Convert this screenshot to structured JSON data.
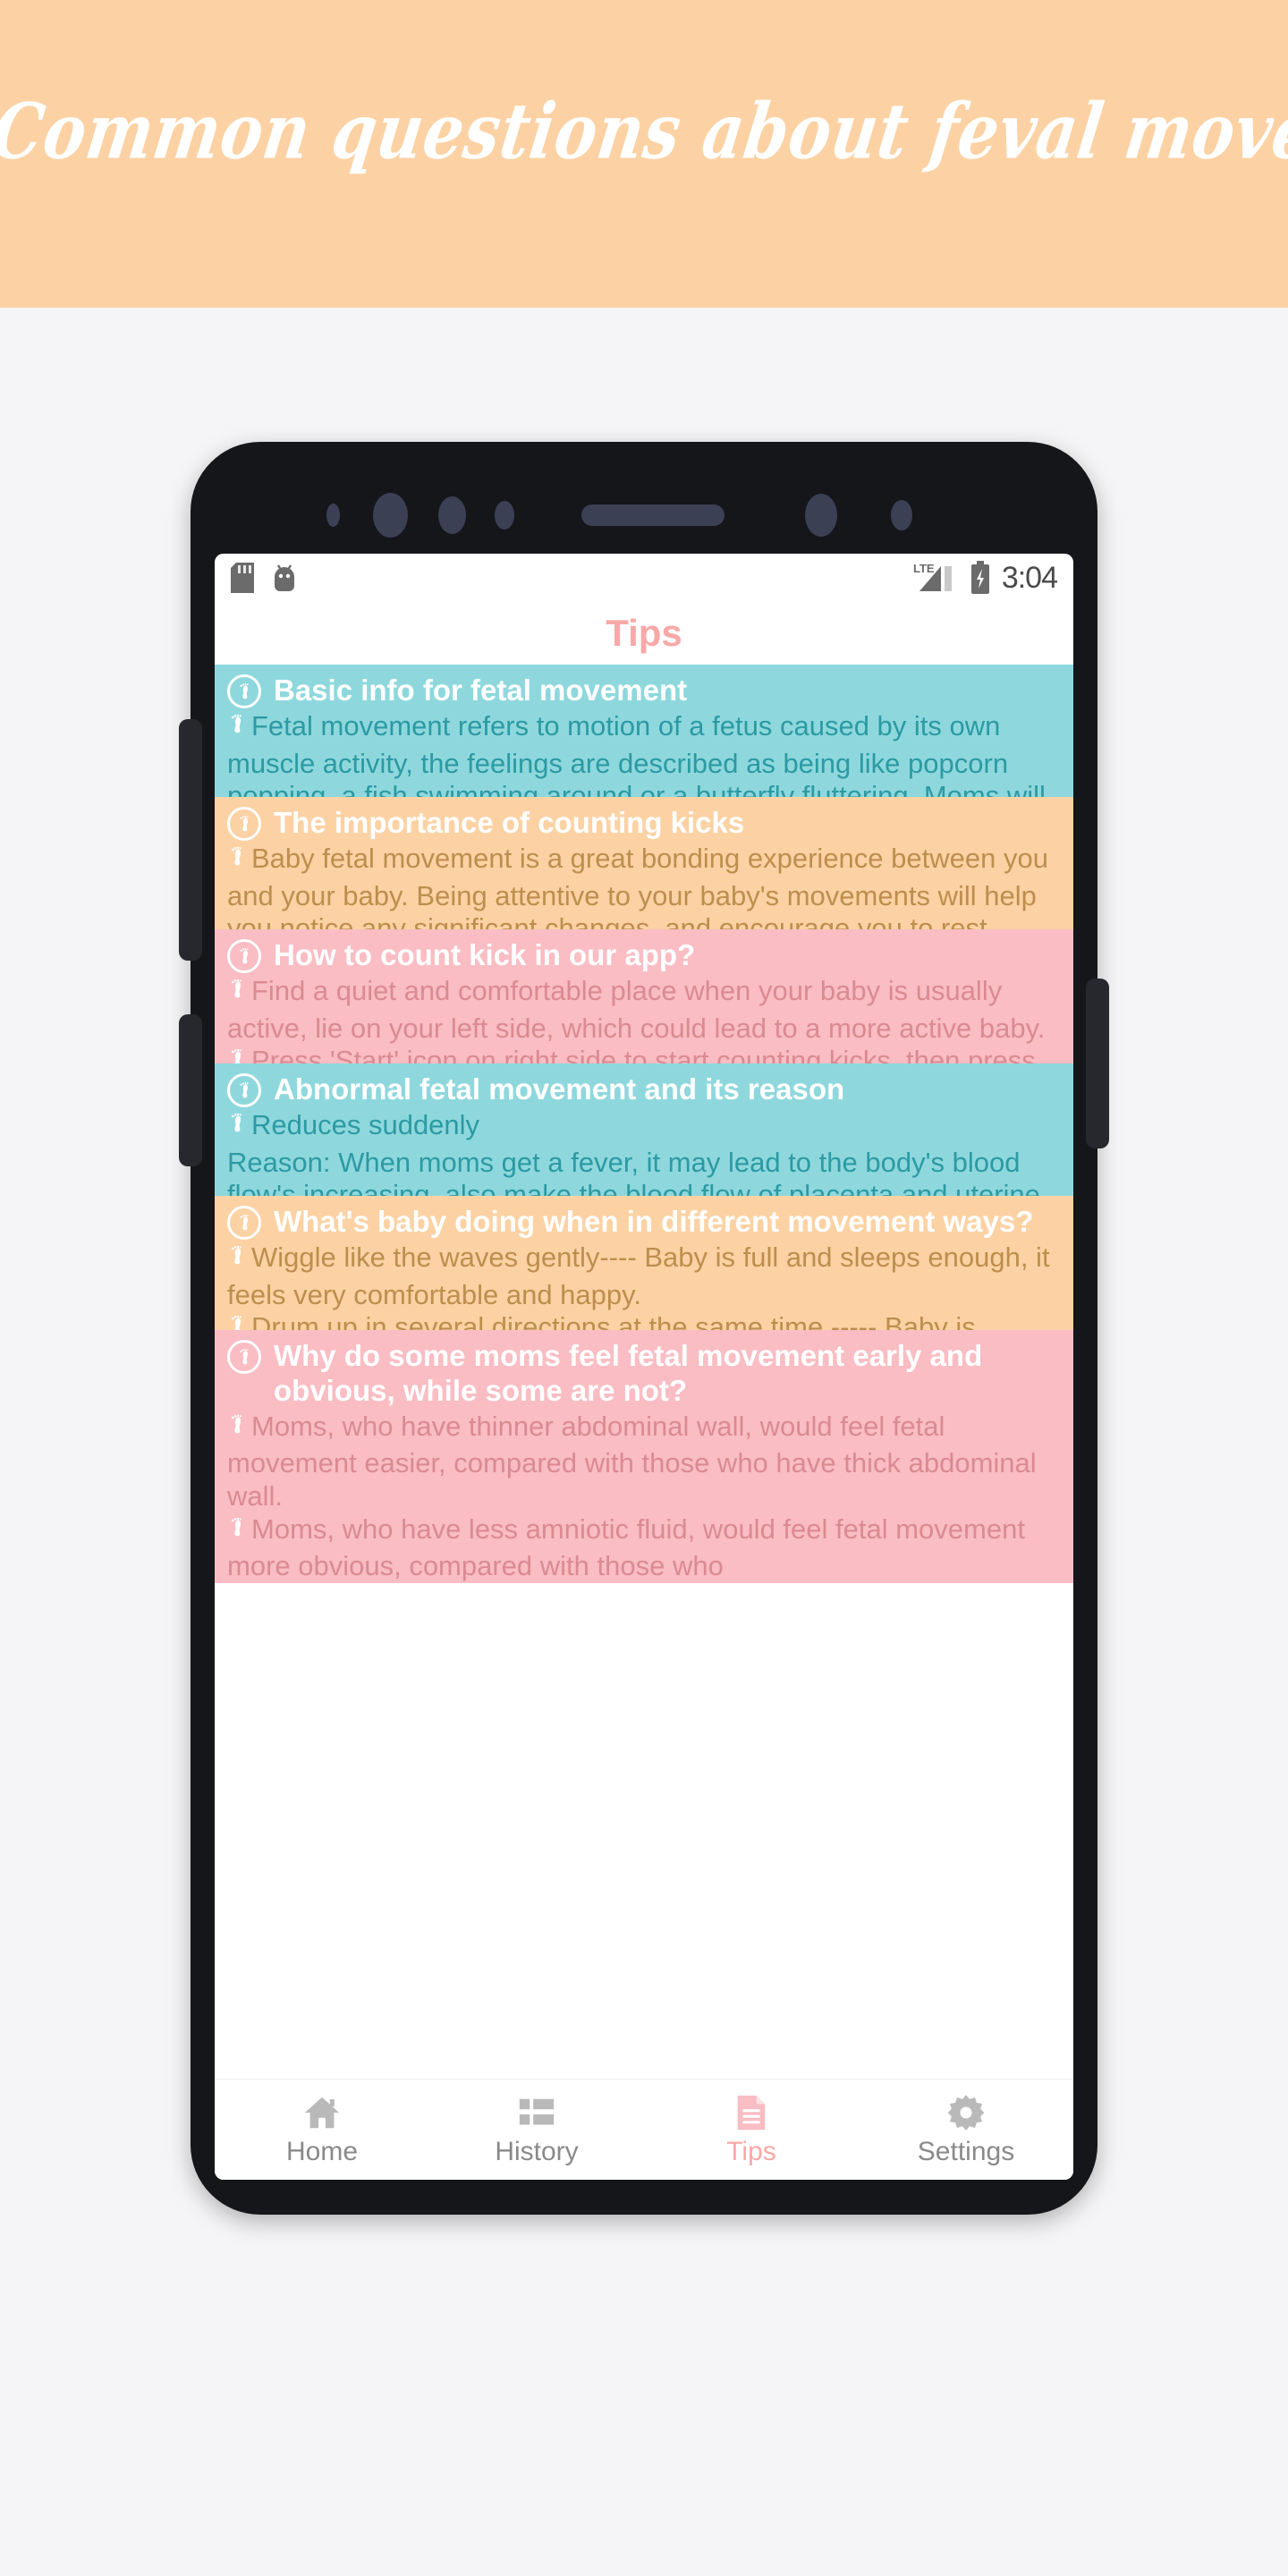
{
  "banner": {
    "title": "Common questions about feval movement",
    "bg_color": "#fcd2a4",
    "text_color": "#ffffff"
  },
  "phone": {
    "status_bar": {
      "time": "3:04",
      "left_icons": [
        "sd-card-icon",
        "android-icon"
      ],
      "right_icons": [
        "lte-signal-icon",
        "battery-charging-icon"
      ],
      "network_label": "LTE"
    },
    "app_bar": {
      "title": "Tips",
      "title_color": "#f9a8a8"
    },
    "cards": [
      {
        "theme": "teal",
        "bg_color": "#8ed8dd",
        "text_color": "#2c9aa3",
        "title": "Basic info for fetal movement",
        "paragraphs": [
          "Fetal movement refers to motion of a fetus caused by its own muscle activity, the feelings are described as being like popcorn popping, a fish swimming around or a butterfly fluttering. Moms will begin to feel the movement between 18-25 weeks into pregnancy. For"
        ]
      },
      {
        "theme": "peach",
        "bg_color": "#fcd2a4",
        "text_color": "#bd8e4d",
        "title": "The importance of counting kicks",
        "paragraphs": [
          "Baby fetal movement is a great bonding experience between you and your baby. Being attentive to your baby's movements will help you notice any significant changes, and encourage you to rest. Setting aside time every day to count kicks may help identify potential"
        ]
      },
      {
        "theme": "pink",
        "bg_color": "#f9bdc3",
        "text_color": "#db8a92",
        "title": "How to count kick in our app?",
        "paragraphs": [
          "Find a quiet and comfortable place when your baby is usually active, lie on your left side, which could lead to a more active baby.",
          "Press 'Start' icon on right side to start counting kicks, then press 'Feet' icon in the middle every time when"
        ]
      },
      {
        "theme": "teal",
        "bg_color": "#8ed8dd",
        "text_color": "#2c9aa3",
        "title": "Abnormal fetal movement and its reason",
        "paragraphs": [
          "Reduces suddenly",
          "Reason: When moms get a fever, it may lead to the body's blood flow's increasing, also make the blood flow of placenta and uterine reduce, which would cause the baby to lack of oxygen."
        ],
        "paragraph_bullets": [
          true,
          false
        ]
      },
      {
        "theme": "peach",
        "bg_color": "#fcd2a4",
        "text_color": "#bd8e4d",
        "title": "What's baby doing when in different movement ways?",
        "paragraphs": [
          "Wiggle like the waves gently---- Baby is full and sleeps enough, it feels very comfortable and happy.",
          "Drum up in several directions at the same time ----- Baby is stretching itself, it's usually caused by the"
        ]
      },
      {
        "theme": "pink",
        "bg_color": "#f9bdc3",
        "text_color": "#db8a92",
        "title": "Why do some moms feel fetal movement early and obvious, while some are not?",
        "paragraphs": [
          "Moms, who have thinner abdominal wall, would feel fetal movement easier, compared with those who have thick abdominal wall.",
          "Moms, who have less amniotic fluid, would feel fetal movement more obvious, compared with those who"
        ]
      }
    ],
    "bottom_nav": [
      {
        "label": "Home",
        "icon": "home-icon",
        "active": false
      },
      {
        "label": "History",
        "icon": "list-icon",
        "active": false
      },
      {
        "label": "Tips",
        "icon": "document-icon",
        "active": true
      },
      {
        "label": "Settings",
        "icon": "gear-icon",
        "active": false
      }
    ]
  }
}
